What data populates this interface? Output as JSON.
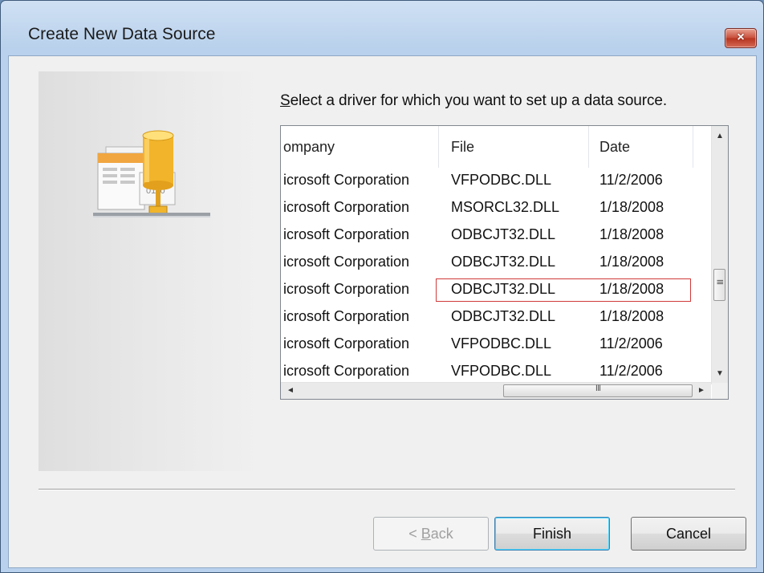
{
  "window": {
    "title": "Create New Data Source",
    "close_glyph": "×"
  },
  "instruction": {
    "prefix_underlined": "S",
    "text": "elect a driver for which you want to set up a data source."
  },
  "driver_list": {
    "columns": [
      "ompany",
      "File",
      "Date"
    ],
    "rows": [
      {
        "company": "icrosoft Corporation",
        "file": "VFPODBC.DLL",
        "date": "11/2/2006"
      },
      {
        "company": "icrosoft Corporation",
        "file": "MSORCL32.DLL",
        "date": "1/18/2008"
      },
      {
        "company": "icrosoft Corporation",
        "file": "ODBCJT32.DLL",
        "date": "1/18/2008"
      },
      {
        "company": "icrosoft Corporation",
        "file": "ODBCJT32.DLL",
        "date": "1/18/2008"
      },
      {
        "company": "icrosoft Corporation",
        "file": "ODBCJT32.DLL",
        "date": "1/18/2008"
      },
      {
        "company": "icrosoft Corporation",
        "file": "ODBCJT32.DLL",
        "date": "1/18/2008"
      },
      {
        "company": "icrosoft Corporation",
        "file": "VFPODBC.DLL",
        "date": "11/2/2006"
      },
      {
        "company": "icrosoft Corporation",
        "file": "VFPODBC.DLL",
        "date": "11/2/2006"
      }
    ],
    "highlighted_row_index": 4
  },
  "scrollbars": {
    "up_arrow": "▲",
    "down_arrow": "▼",
    "left_arrow": "◄",
    "right_arrow": "►",
    "grip": "III"
  },
  "buttons": {
    "back": {
      "underline": "B",
      "rest": "ack",
      "prefix": "< "
    },
    "finish": "Finish",
    "cancel": "Cancel"
  },
  "icons": {
    "panel_icon": "database-network-icon"
  },
  "colors": {
    "highlight_outline": "#d13a3a",
    "default_button_glow": "#48d6ff"
  }
}
